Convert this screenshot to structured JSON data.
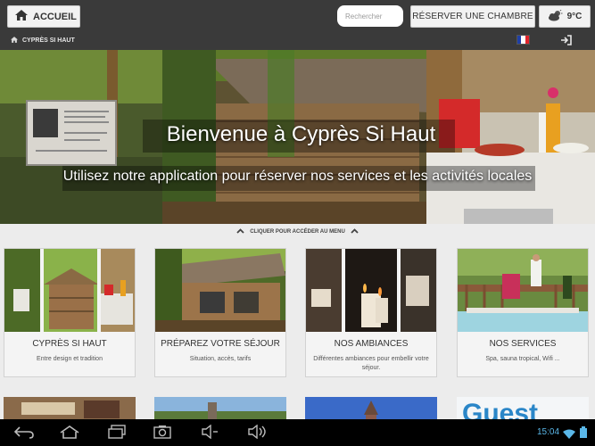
{
  "topbar": {
    "home_label": "ACCUEIL",
    "search_placeholder": "Rechercher",
    "reserve_label": "RÉSERVER UNE CHAMBRE",
    "weather_temp": "9°C",
    "weather_icon": "cloud-sun-icon"
  },
  "breadcrumb": {
    "home_icon": "home-icon",
    "current": "CYPRÈS SI HAUT",
    "language_flag": "french-flag-icon",
    "login_icon": "login-icon"
  },
  "hero": {
    "title": "Bienvenue à Cyprès Si Haut",
    "subtitle": "Utilisez notre application pour réserver nos services et les activités locales"
  },
  "menu_hint": "CLIQUER POUR ACCÉDER AU MENU",
  "cards": [
    {
      "title": "CYPRÈS SI HAUT",
      "subtitle": "Entre design et tradition"
    },
    {
      "title": "PRÉPAREZ VOTRE SÉJOUR",
      "subtitle": "Situation, accès, tarifs"
    },
    {
      "title": "NOS AMBIANCES",
      "subtitle": "Différentes ambiances pour embellir votre séjour."
    },
    {
      "title": "NOS SERVICES",
      "subtitle": "Spa, sauna tropical, Wifi ..."
    }
  ],
  "android_bar": {
    "time": "15:04",
    "icons": [
      "back-icon",
      "home-icon",
      "recent-apps-icon",
      "camera-icon",
      "volume-down-icon",
      "volume-up-icon",
      "wifi-icon",
      "battery-icon"
    ]
  },
  "colors": {
    "topbar_bg": "#3a3a3a",
    "page_bg": "#ececec",
    "clock": "#5ab7e8"
  }
}
